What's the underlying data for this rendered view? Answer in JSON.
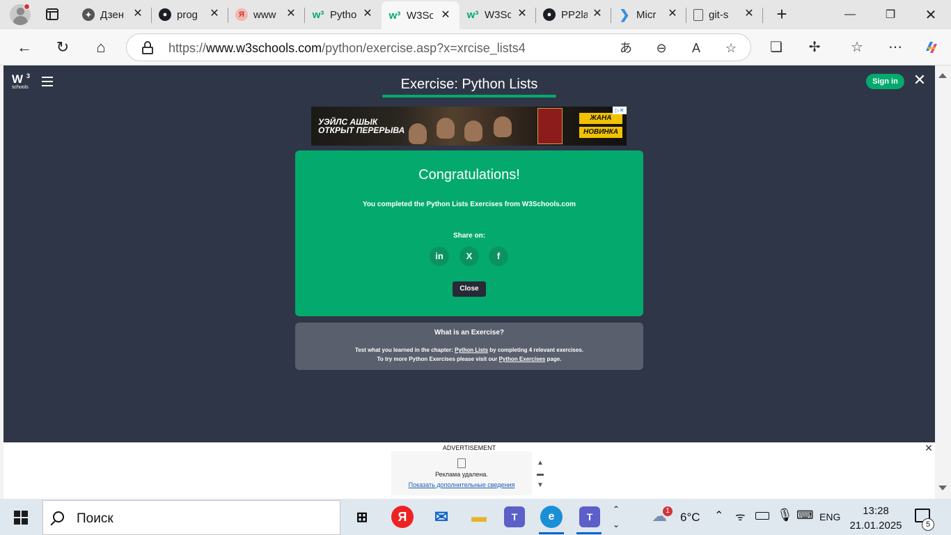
{
  "browser": {
    "tabs": [
      {
        "label": "Дзен",
        "favicon": "dzen-icon"
      },
      {
        "label": "prog",
        "favicon": "github-icon"
      },
      {
        "label": "www",
        "favicon": "yandex-icon"
      },
      {
        "label": "Pytho",
        "favicon": "w3schools-icon"
      },
      {
        "label": "W3Sc",
        "favicon": "w3schools-icon",
        "active": true
      },
      {
        "label": "W3Sc",
        "favicon": "w3schools-icon"
      },
      {
        "label": "PP2la",
        "favicon": "github-icon"
      },
      {
        "label": "Micr",
        "favicon": "vscode-icon"
      },
      {
        "label": "git-s",
        "favicon": "document-icon"
      }
    ],
    "url_prefix": "https://",
    "url_host": "www.w3schools.com",
    "url_path": "/python/exercise.asp?x=xrcise_lists4"
  },
  "page": {
    "logo_text": "W",
    "logo_sup": "3",
    "logo_small": "schools",
    "title": "Exercise: Python Lists",
    "sign_in": "Sign in",
    "ad_banner": {
      "left_line1": "УЭЙЛС АШЫК",
      "left_line2": "ОТКРЫТ ПЕРЕРЫВА",
      "badge1": "ЖАНА",
      "badge2": "НОВИНКА"
    },
    "congrats": {
      "title": "Congratulations!",
      "message": "You completed the Python Lists Exercises from W3Schools.com",
      "share_label": "Share on:",
      "share_linkedin": "in",
      "share_x": "X",
      "share_facebook": "f",
      "close": "Close"
    },
    "info": {
      "question": "What is an Exercise?",
      "line1_pre": "Test what you learned in the chapter: ",
      "line1_link": "Python Lists",
      "line1_post": " by completing 4 relevant exercises.",
      "line2_pre": "To try more Python Exercises please visit our ",
      "line2_link": "Python Exercises",
      "line2_post": " page."
    },
    "bottom_ad": {
      "label": "ADVERTISEMENT",
      "removed": "Реклама удалена.",
      "more": "Показать дополнительные сведения"
    }
  },
  "taskbar": {
    "search_placeholder": "Поиск",
    "weather_temp": "6°C",
    "weather_badge": "1",
    "language": "ENG",
    "time": "13:28",
    "date": "21.01.2025",
    "notifications": "5"
  }
}
